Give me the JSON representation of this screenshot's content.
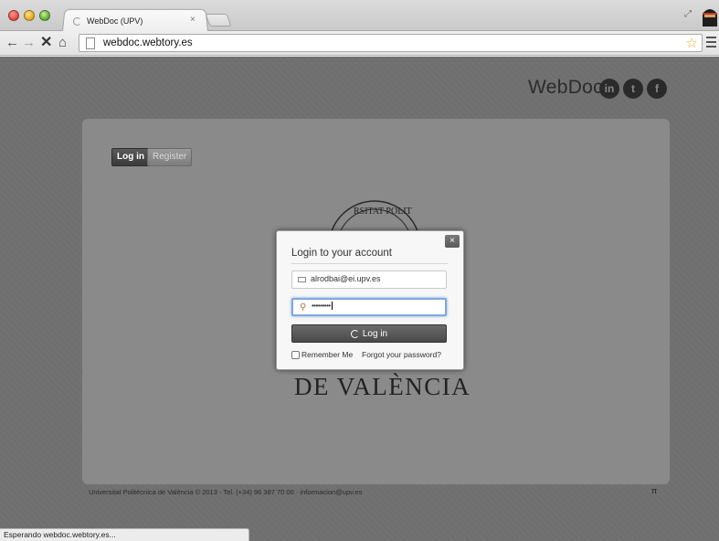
{
  "browser": {
    "tab_title": "WebDoc (UPV)",
    "tab_close": "×",
    "url": "webdoc.webtory.es",
    "status_text": "Esperando webdoc.webtory.es..."
  },
  "site": {
    "brand": "WebDoc",
    "social": [
      "in",
      "t",
      "f"
    ],
    "nav": {
      "login_label": "Log in",
      "register_label": "Register"
    },
    "university_name": "DE VALÈNCIA",
    "footer": "Universitat Politècnica de València © 2013 · Tel. (+34) 96 387 70 00 · informacion@upv.es",
    "footer_symbol": "π"
  },
  "modal": {
    "title": "Login to your account",
    "close_label": "×",
    "email_value": "alrodbai@ei.upv.es",
    "password_mask": "•••••••••",
    "submit_label": "Log in",
    "remember_label": "Remember Me",
    "forgot_label": "Forgot your password?"
  },
  "colors": {
    "page_bg": "#6f6f6f",
    "panel_bg": "#8a8a8a",
    "focus_ring": "#7fa8e0"
  }
}
